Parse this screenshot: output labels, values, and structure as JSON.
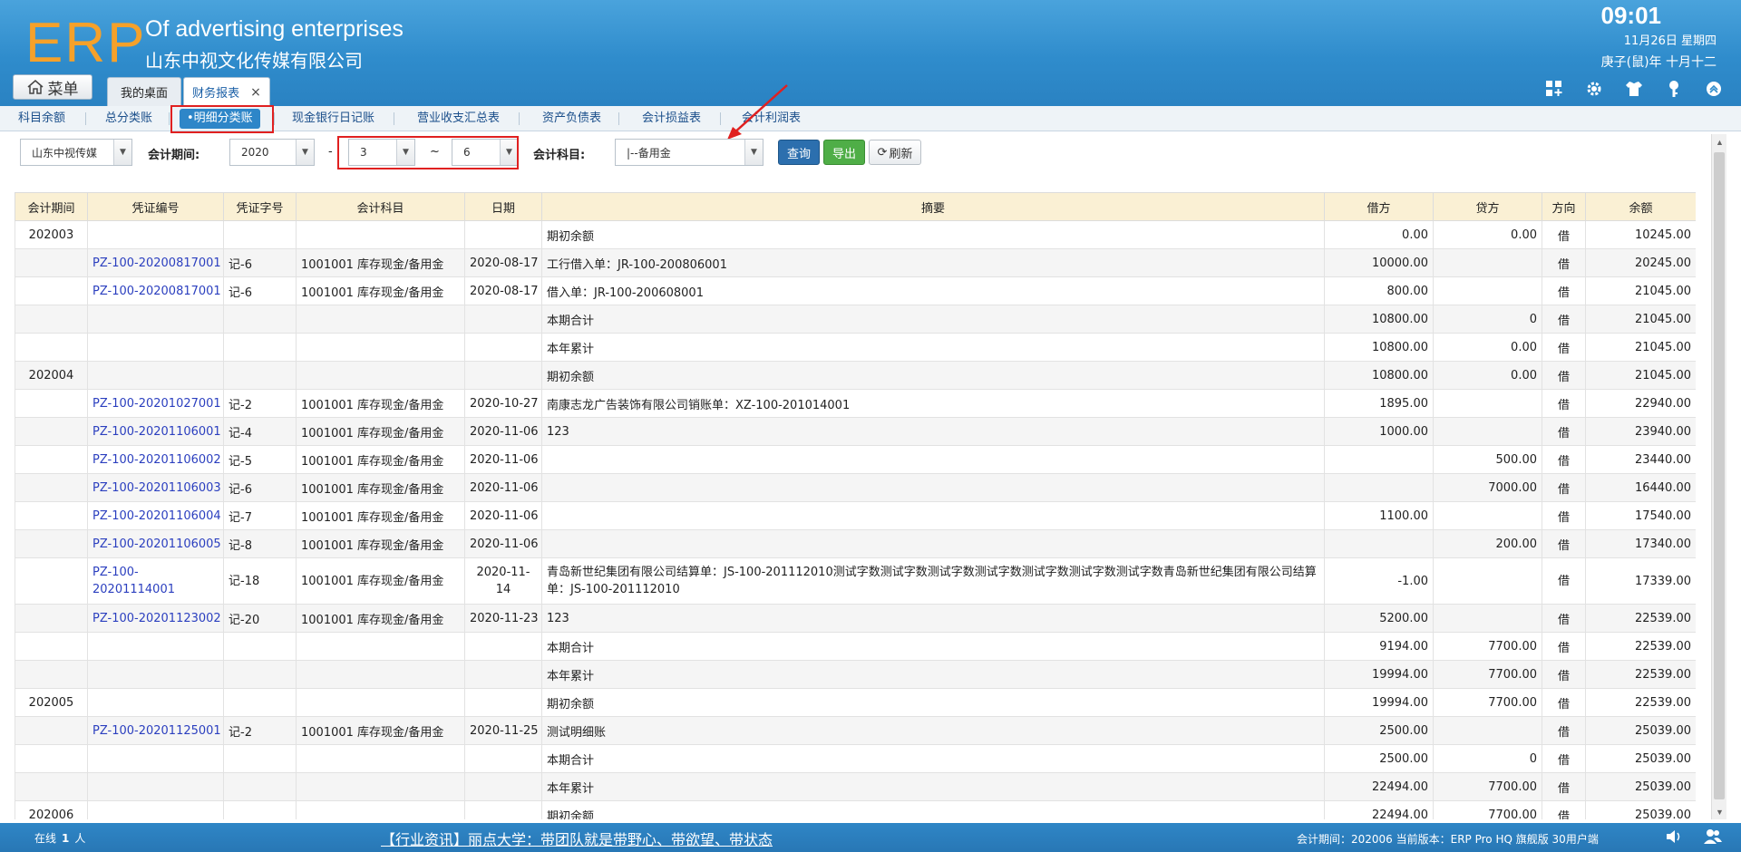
{
  "header": {
    "logo": "ERP",
    "brand_en": "Of advertising enterprises",
    "brand_cn": "山东中视文化传媒有限公司",
    "time": "09:01",
    "date": "11月26日 星期四",
    "lunar": "庚子(鼠)年 十月十二",
    "menu_label": "菜单",
    "tabs": [
      {
        "label": "我的桌面"
      },
      {
        "label": "财务报表",
        "close": "×"
      }
    ]
  },
  "subnav": {
    "items": [
      "科目余额",
      "总分类账",
      "•明细分类账",
      "现金银行日记账",
      "营业收支汇总表",
      "资产负债表",
      "会计损益表",
      "会计利润表"
    ]
  },
  "filters": {
    "company": "山东中视传媒",
    "period_label": "会计期间:",
    "year": "2020",
    "dash": "-",
    "month_from": "3",
    "tilde": "~",
    "month_to": "6",
    "subject_label": "会计科目:",
    "subject": "|--备用金",
    "query": "查询",
    "export": "导出",
    "refresh": "刷新"
  },
  "table": {
    "headers": [
      "会计期间",
      "凭证编号",
      "凭证字号",
      "会计科目",
      "日期",
      "摘要",
      "借方",
      "贷方",
      "方向",
      "余额"
    ],
    "rows": [
      [
        "202003",
        "",
        "",
        "",
        "",
        "期初余额",
        "0.00",
        "0.00",
        "借",
        "10245.00"
      ],
      [
        "",
        "PZ-100-20200817001",
        "记-6",
        "1001001 库存现金/备用金",
        "2020-08-17",
        "工行借入单：JR-100-200806001",
        "10000.00",
        "",
        "借",
        "20245.00"
      ],
      [
        "",
        "PZ-100-20200817001",
        "记-6",
        "1001001 库存现金/备用金",
        "2020-08-17",
        "借入单：JR-100-200608001",
        "800.00",
        "",
        "借",
        "21045.00"
      ],
      [
        "",
        "",
        "",
        "",
        "",
        "本期合计",
        "10800.00",
        "0",
        "借",
        "21045.00"
      ],
      [
        "",
        "",
        "",
        "",
        "",
        "本年累计",
        "10800.00",
        "0.00",
        "借",
        "21045.00"
      ],
      [
        "202004",
        "",
        "",
        "",
        "",
        "期初余额",
        "10800.00",
        "0.00",
        "借",
        "21045.00"
      ],
      [
        "",
        "PZ-100-20201027001",
        "记-2",
        "1001001 库存现金/备用金",
        "2020-10-27",
        "南康志龙广告装饰有限公司销账单：XZ-100-201014001",
        "1895.00",
        "",
        "借",
        "22940.00"
      ],
      [
        "",
        "PZ-100-20201106001",
        "记-4",
        "1001001 库存现金/备用金",
        "2020-11-06",
        "123",
        "1000.00",
        "",
        "借",
        "23940.00"
      ],
      [
        "",
        "PZ-100-20201106002",
        "记-5",
        "1001001 库存现金/备用金",
        "2020-11-06",
        "",
        "",
        "500.00",
        "借",
        "23440.00"
      ],
      [
        "",
        "PZ-100-20201106003",
        "记-6",
        "1001001 库存现金/备用金",
        "2020-11-06",
        "",
        "",
        "7000.00",
        "借",
        "16440.00"
      ],
      [
        "",
        "PZ-100-20201106004",
        "记-7",
        "1001001 库存现金/备用金",
        "2020-11-06",
        "",
        "1100.00",
        "",
        "借",
        "17540.00"
      ],
      [
        "",
        "PZ-100-20201106005",
        "记-8",
        "1001001 库存现金/备用金",
        "2020-11-06",
        "",
        "",
        "200.00",
        "借",
        "17340.00"
      ],
      [
        "",
        "PZ-100-20201114001",
        "记-18",
        "1001001 库存现金/备用金",
        "2020-11-14",
        "青岛新世纪集团有限公司结算单：JS-100-201112010测试字数测试字数测试字数测试字数测试字数测试字数测试字数青岛新世纪集团有限公司结算单：JS-100-201112010",
        "-1.00",
        "",
        "借",
        "17339.00"
      ],
      [
        "",
        "PZ-100-20201123002",
        "记-20",
        "1001001 库存现金/备用金",
        "2020-11-23",
        "123",
        "5200.00",
        "",
        "借",
        "22539.00"
      ],
      [
        "",
        "",
        "",
        "",
        "",
        "本期合计",
        "9194.00",
        "7700.00",
        "借",
        "22539.00"
      ],
      [
        "",
        "",
        "",
        "",
        "",
        "本年累计",
        "19994.00",
        "7700.00",
        "借",
        "22539.00"
      ],
      [
        "202005",
        "",
        "",
        "",
        "",
        "期初余额",
        "19994.00",
        "7700.00",
        "借",
        "22539.00"
      ],
      [
        "",
        "PZ-100-20201125001",
        "记-2",
        "1001001 库存现金/备用金",
        "2020-11-25",
        "测试明细账",
        "2500.00",
        "",
        "借",
        "25039.00"
      ],
      [
        "",
        "",
        "",
        "",
        "",
        "本期合计",
        "2500.00",
        "0",
        "借",
        "25039.00"
      ],
      [
        "",
        "",
        "",
        "",
        "",
        "本年累计",
        "22494.00",
        "7700.00",
        "借",
        "25039.00"
      ],
      [
        "202006",
        "",
        "",
        "",
        "",
        "期初余额",
        "22494.00",
        "7700.00",
        "借",
        "25039.00"
      ]
    ]
  },
  "footer": {
    "online_label": "在线",
    "online_count": "1",
    "online_unit": "人",
    "news": "【行业资讯】丽点大学：带团队就是带野心、带欲望、带状态",
    "version": "会计期间：202006 当前版本：ERP Pro HQ 旗舰版 30用户端"
  },
  "colors": {
    "header_blue": "#2f8ccc",
    "logo_orange": "#f5a12a",
    "link_blue": "#2b3fbf",
    "highlight_red": "#e02020",
    "query_button": "#2c6fae",
    "export_button": "#4fae47"
  }
}
